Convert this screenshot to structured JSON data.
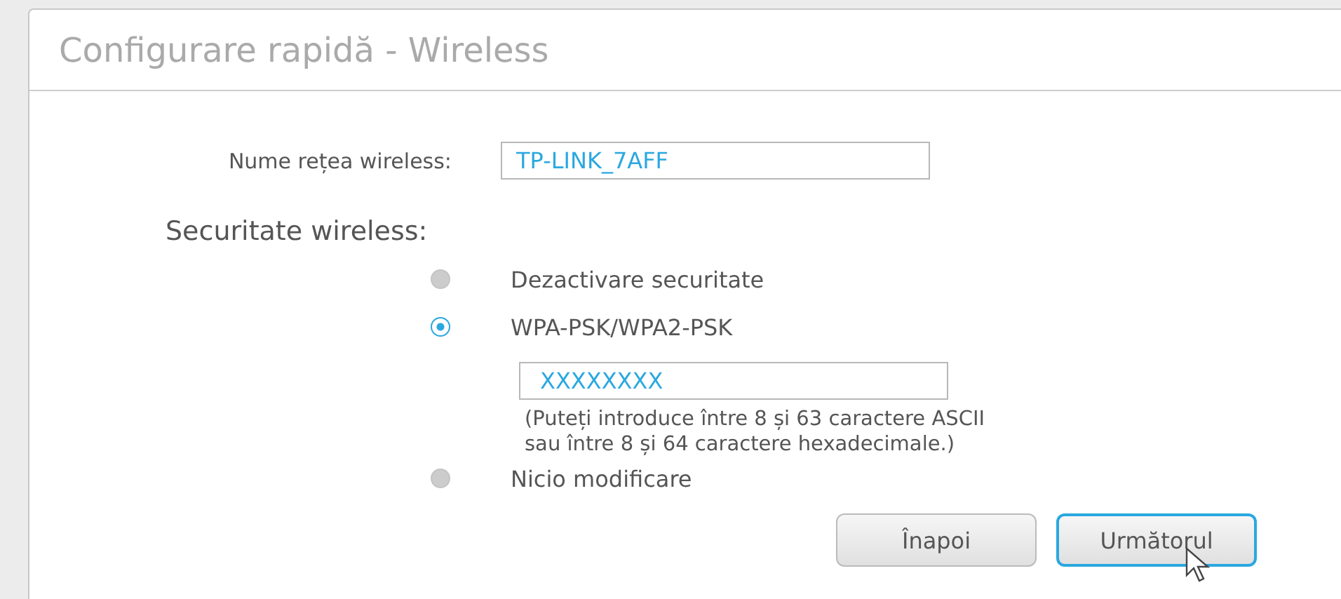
{
  "title": "Configurare rapidă - Wireless",
  "network_name": {
    "label": "Nume rețea wireless:",
    "value": "TP-LINK_7AFF"
  },
  "security": {
    "label": "Securitate wireless:",
    "options": [
      {
        "label": "Dezactivare securitate",
        "selected": false
      },
      {
        "label": "WPA-PSK/WPA2-PSK",
        "selected": true,
        "password": "XXXXXXXX",
        "hint": "(Puteți introduce între 8 și 63 caractere ASCII sau între 8 și 64 caractere hexadecimale.)"
      },
      {
        "label": "Nicio modificare",
        "selected": false
      }
    ]
  },
  "buttons": [
    {
      "label": "Înapoi",
      "focused": false
    },
    {
      "label": "Următorul",
      "focused": true
    }
  ]
}
